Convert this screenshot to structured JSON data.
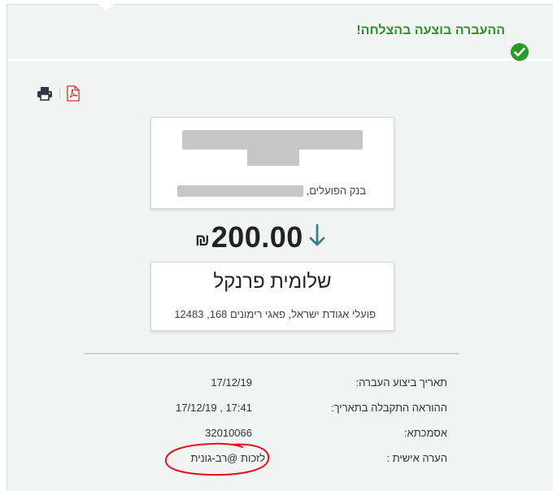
{
  "success": {
    "message": "ההעברה בוצעה בהצלחה!",
    "icon": "check-circle-icon",
    "color": "#2a9a2a"
  },
  "toolbar": {
    "print_icon": "print-icon",
    "pdf_icon": "pdf-icon"
  },
  "bank_card": {
    "bank_name": "בנק הפועלים,"
  },
  "transfer": {
    "amount": "200.00",
    "currency": "₪",
    "direction_icon": "arrow-down-icon",
    "arrow_color": "#3a7f8a"
  },
  "payee": {
    "name": "שלומית פרנקל",
    "address": "פועלי אגודת ישראל, פאגי רימונים 168, 12483"
  },
  "details": {
    "execution_date_label": "תאריך ביצוע העברה:",
    "execution_date_value": "17/12/19",
    "received_label": "ההוראה התקבלה בתאריך:",
    "received_value": "17/12/19 , 17:41",
    "reference_label": "אסמכתא:",
    "reference_value": "32010066",
    "note_label": "הערה אישית :",
    "note_value": "לזכות @רב-גונית"
  },
  "annotation_color": "#e0141b"
}
